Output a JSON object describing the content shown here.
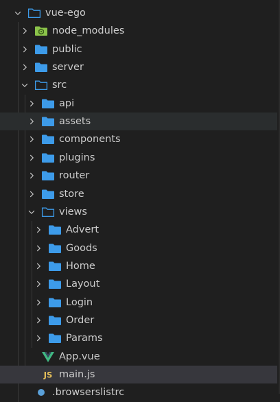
{
  "explorer": {
    "items": [
      {
        "label": "vue-ego",
        "kind": "folder-open",
        "depth": 0,
        "expanded": true
      },
      {
        "label": "node_modules",
        "kind": "folder-node",
        "depth": 1,
        "expanded": false
      },
      {
        "label": "public",
        "kind": "folder",
        "depth": 1,
        "expanded": false
      },
      {
        "label": "server",
        "kind": "folder",
        "depth": 1,
        "expanded": false
      },
      {
        "label": "src",
        "kind": "folder-open",
        "depth": 1,
        "expanded": true
      },
      {
        "label": "api",
        "kind": "folder",
        "depth": 2,
        "expanded": false
      },
      {
        "label": "assets",
        "kind": "folder",
        "depth": 2,
        "expanded": false,
        "hover": true
      },
      {
        "label": "components",
        "kind": "folder",
        "depth": 2,
        "expanded": false
      },
      {
        "label": "plugins",
        "kind": "folder",
        "depth": 2,
        "expanded": false
      },
      {
        "label": "router",
        "kind": "folder",
        "depth": 2,
        "expanded": false
      },
      {
        "label": "store",
        "kind": "folder",
        "depth": 2,
        "expanded": false
      },
      {
        "label": "views",
        "kind": "folder-open",
        "depth": 2,
        "expanded": true
      },
      {
        "label": "Advert",
        "kind": "folder",
        "depth": 3,
        "expanded": false
      },
      {
        "label": "Goods",
        "kind": "folder",
        "depth": 3,
        "expanded": false
      },
      {
        "label": "Home",
        "kind": "folder",
        "depth": 3,
        "expanded": false
      },
      {
        "label": "Layout",
        "kind": "folder",
        "depth": 3,
        "expanded": false
      },
      {
        "label": "Login",
        "kind": "folder",
        "depth": 3,
        "expanded": false
      },
      {
        "label": "Order",
        "kind": "folder",
        "depth": 3,
        "expanded": false
      },
      {
        "label": "Params",
        "kind": "folder",
        "depth": 3,
        "expanded": false
      },
      {
        "label": "App.vue",
        "kind": "vue-file",
        "depth": 2
      },
      {
        "label": "main.js",
        "kind": "js-file",
        "depth": 2,
        "selected": true
      },
      {
        "label": ".browserslistrc",
        "kind": "config-file",
        "depth": 1
      }
    ]
  },
  "colors": {
    "folder": "#3d9be9",
    "folder_node": "#8bc34a",
    "vue": "#41b883",
    "js": "#e8c15a",
    "text": "#cccccc",
    "background": "#1f1f1f"
  }
}
